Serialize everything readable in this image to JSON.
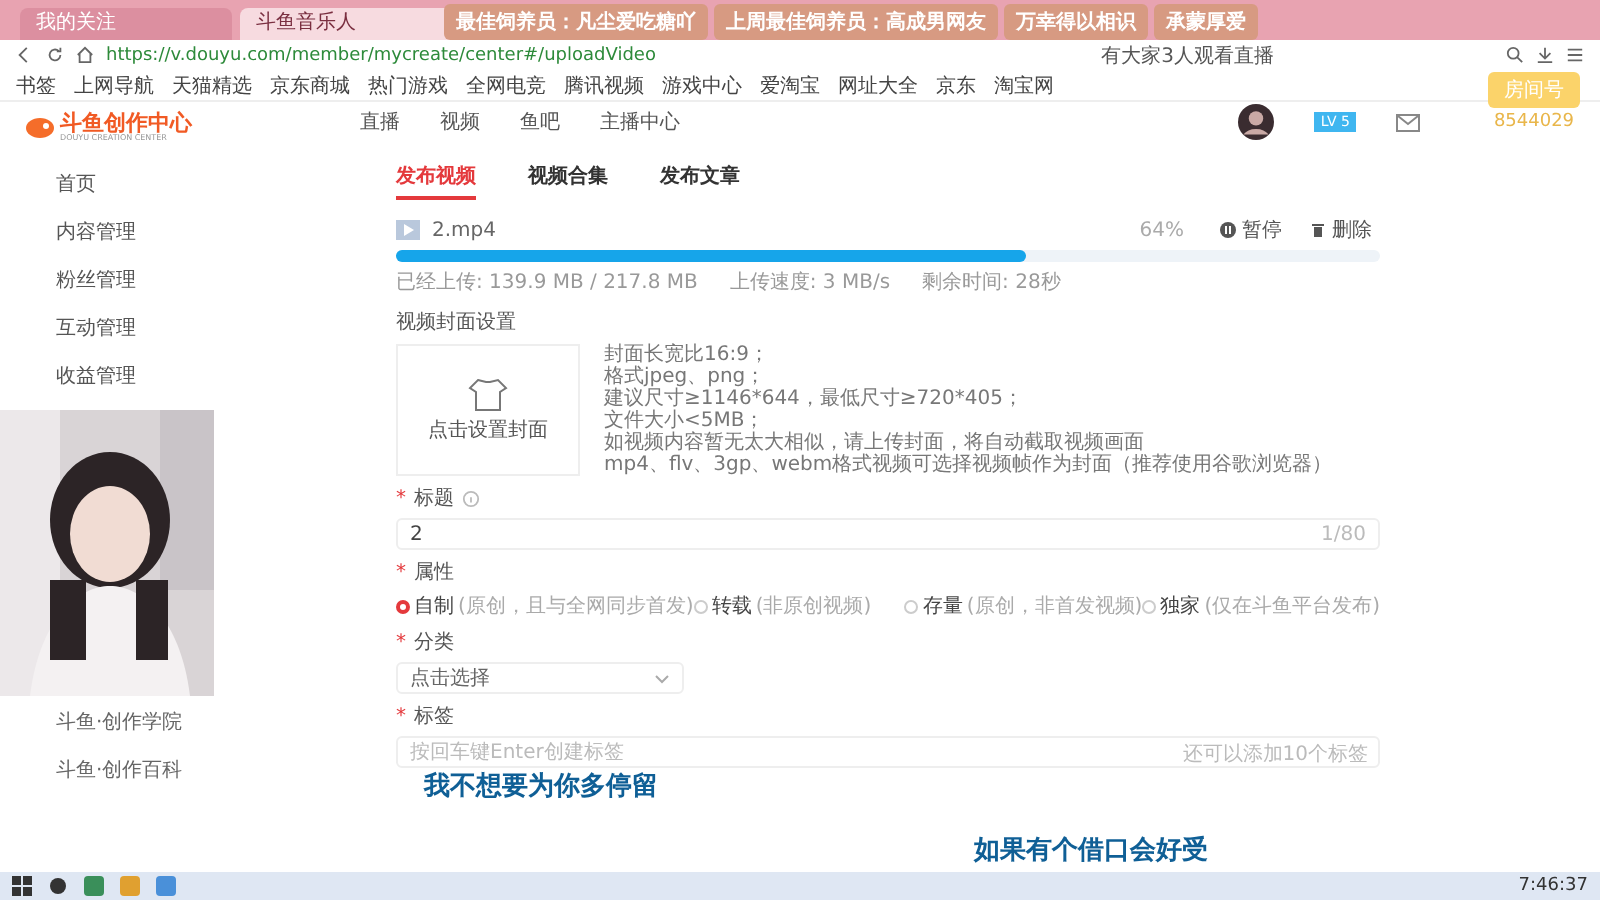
{
  "browser": {
    "tabs": [
      {
        "label": "我的关注",
        "selected": false
      },
      {
        "label": "斗鱼音乐人",
        "selected": true
      }
    ],
    "url": "https://v.douyu.com/member/mycreate/center#/uploadVideo",
    "news": "有大家3人观看直播",
    "bookmarks": [
      "书签",
      "上网导航",
      "天猫精选",
      "京东商城",
      "热门游戏",
      "全网电竞",
      "腾讯视频",
      "游戏中心",
      "爱淘宝",
      "网址大全",
      "京东",
      "淘宝网"
    ]
  },
  "gift_banners": [
    "最佳饲养员：凡尘爱吃糖吖",
    "上周最佳饲养员：高成男网友",
    "万幸得以相识",
    "承蒙厚爱"
  ],
  "site": {
    "logo": "斗鱼创作中心",
    "logo_sub": "DOUYU CREATION CENTER",
    "nav": [
      "直播",
      "视频",
      "鱼吧",
      "主播中心"
    ],
    "level_badge": "LV 5"
  },
  "sidebar": {
    "menu": [
      "首页",
      "内容管理",
      "粉丝管理",
      "互动管理",
      "收益管理"
    ],
    "links": [
      "斗鱼·创作学院",
      "斗鱼·创作百科"
    ]
  },
  "upload_tabs": [
    {
      "label": "发布视频",
      "selected": true
    },
    {
      "label": "视频合集",
      "selected": false
    },
    {
      "label": "发布文章",
      "selected": false
    }
  ],
  "upload": {
    "file": "2.mp4",
    "level": 0.64,
    "percent": "64%",
    "actions": [
      {
        "kind": "pause",
        "label": "暂停"
      },
      {
        "kind": "delete",
        "label": "删除"
      }
    ],
    "stats": [
      "已经上传: 139.9 MB / 217.8 MB",
      "上传速度: 3 MB/s",
      "剩余时间: 28秒"
    ]
  },
  "cover": {
    "heading": "视频封面设置",
    "button": "点击设置封面",
    "rules": [
      "封面长宽比16:9；",
      "格式jpeg、png；",
      "建议尺寸≥1146*644，最低尺寸≥720*405；",
      "文件大小<5MB；",
      "如视频内容暂无太大相似，请上传封面，将自动截取视频画面",
      "mp4、flv、3gp、webm格式视频可选择视频帧作为封面（推荐使用谷歌浏览器）"
    ]
  },
  "form": {
    "required_mark": "*",
    "title": {
      "label": "标题",
      "value": "2",
      "counter": "1/80"
    },
    "attribute": {
      "label": "属性",
      "options": [
        {
          "label": "自制",
          "note": "(原创，且与全网同步首发)",
          "selected": true
        },
        {
          "label": "转载",
          "note": "(非原创视频)",
          "selected": false
        },
        {
          "label": "存量",
          "note": "(原创，非首发视频)",
          "selected": false
        },
        {
          "label": "独家",
          "note": "(仅在斗鱼平台发布)",
          "selected": false
        }
      ]
    },
    "category": {
      "label": "分类",
      "placeholder": "点击选择"
    },
    "tags": {
      "label": "标签",
      "placeholder": "按回车键Enter创建标签",
      "hint": "还可以添加10个标签"
    }
  },
  "room": {
    "button": "房间号",
    "number": "8544029"
  },
  "lyrics": [
    "我不想要为你多停留",
    "如果有个借口会好受"
  ],
  "taskbar": {
    "time": "7:46:37"
  }
}
